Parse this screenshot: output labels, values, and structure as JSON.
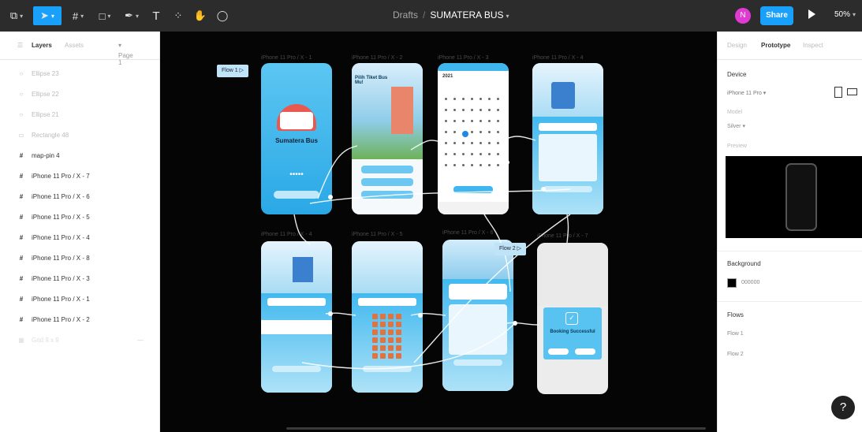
{
  "toolbar": {
    "tools": [
      {
        "name": "main-menu-icon",
        "glyph": "⧉"
      },
      {
        "name": "move-tool-icon",
        "glyph": "➤"
      },
      {
        "name": "frame-tool-icon",
        "glyph": "#"
      },
      {
        "name": "shape-tool-icon",
        "glyph": "□"
      },
      {
        "name": "pen-tool-icon",
        "glyph": "✒"
      },
      {
        "name": "text-tool-icon",
        "glyph": "T"
      },
      {
        "name": "components-icon",
        "glyph": "⁘"
      },
      {
        "name": "hand-tool-icon",
        "glyph": "✋"
      },
      {
        "name": "comment-tool-icon",
        "glyph": "◯"
      }
    ],
    "breadcrumb_drafts": "Drafts",
    "breadcrumb_sep": "/",
    "file_name": "SUMATERA BUS",
    "avatar_initial": "N",
    "share_label": "Share",
    "zoom": "50%"
  },
  "left_panel": {
    "tab_layers": "Layers",
    "tab_assets": "Assets",
    "page_selector": "Page 1",
    "layers": [
      {
        "icon": "○",
        "name": "Ellipse 23",
        "kind": "shape"
      },
      {
        "icon": "○",
        "name": "Ellipse 22",
        "kind": "shape"
      },
      {
        "icon": "○",
        "name": "Ellipse 21",
        "kind": "shape"
      },
      {
        "icon": "▭",
        "name": "Rectangle 48",
        "kind": "shape"
      },
      {
        "icon": "#",
        "name": "map-pin 4",
        "kind": "frame"
      },
      {
        "icon": "#",
        "name": "iPhone 11 Pro / X - 7",
        "kind": "frame"
      },
      {
        "icon": "#",
        "name": "iPhone 11 Pro / X - 6",
        "kind": "frame"
      },
      {
        "icon": "#",
        "name": "iPhone 11 Pro / X - 5",
        "kind": "frame"
      },
      {
        "icon": "#",
        "name": "iPhone 11 Pro / X - 4",
        "kind": "frame"
      },
      {
        "icon": "#",
        "name": "iPhone 11 Pro / X - 8",
        "kind": "frame"
      },
      {
        "icon": "#",
        "name": "iPhone 11 Pro / X - 3",
        "kind": "frame"
      },
      {
        "icon": "#",
        "name": "iPhone 11 Pro / X - 1",
        "kind": "frame"
      },
      {
        "icon": "#",
        "name": "iPhone 11 Pro / X - 2",
        "kind": "frame"
      },
      {
        "icon": "▦",
        "name": "Grid 9 x 9",
        "kind": "dim"
      }
    ]
  },
  "canvas": {
    "frame_labels": [
      "iPhone 11 Pro / X - 1",
      "iPhone 11 Pro / X - 2",
      "iPhone 11 Pro / X - 3",
      "iPhone 11 Pro / X - 4",
      "iPhone 11 Pro / X - 4",
      "iPhone 11 Pro / X - 5",
      "iPhone 11 Pro / X - 6",
      "iPhone 11 Pro / X - 7"
    ],
    "flow1_tag": "Flow 1",
    "flow2_tag": "Flow 2",
    "splash_title": "Sumatera Bus",
    "splash_dots": "•••••",
    "screen2_text": "Pilih Tiket Bus Mu!",
    "calendar_year": "2021",
    "booking_title": "Booking Successful"
  },
  "right_panel": {
    "tab_design": "Design",
    "tab_prototype": "Prototype",
    "tab_inspect": "Inspect",
    "device_label": "Device",
    "device_value": "iPhone 11 Pro",
    "model_label": "Model",
    "model_value": "Silver",
    "preview_label": "Preview",
    "background_label": "Background",
    "background_value": "000000",
    "flows_label": "Flows",
    "flows": [
      "Flow 1",
      "Flow 2"
    ],
    "help": "?"
  },
  "colors": {
    "accent": "#18a0fb",
    "canvas": "#050505",
    "screen_blue": "#3fb7ee"
  }
}
